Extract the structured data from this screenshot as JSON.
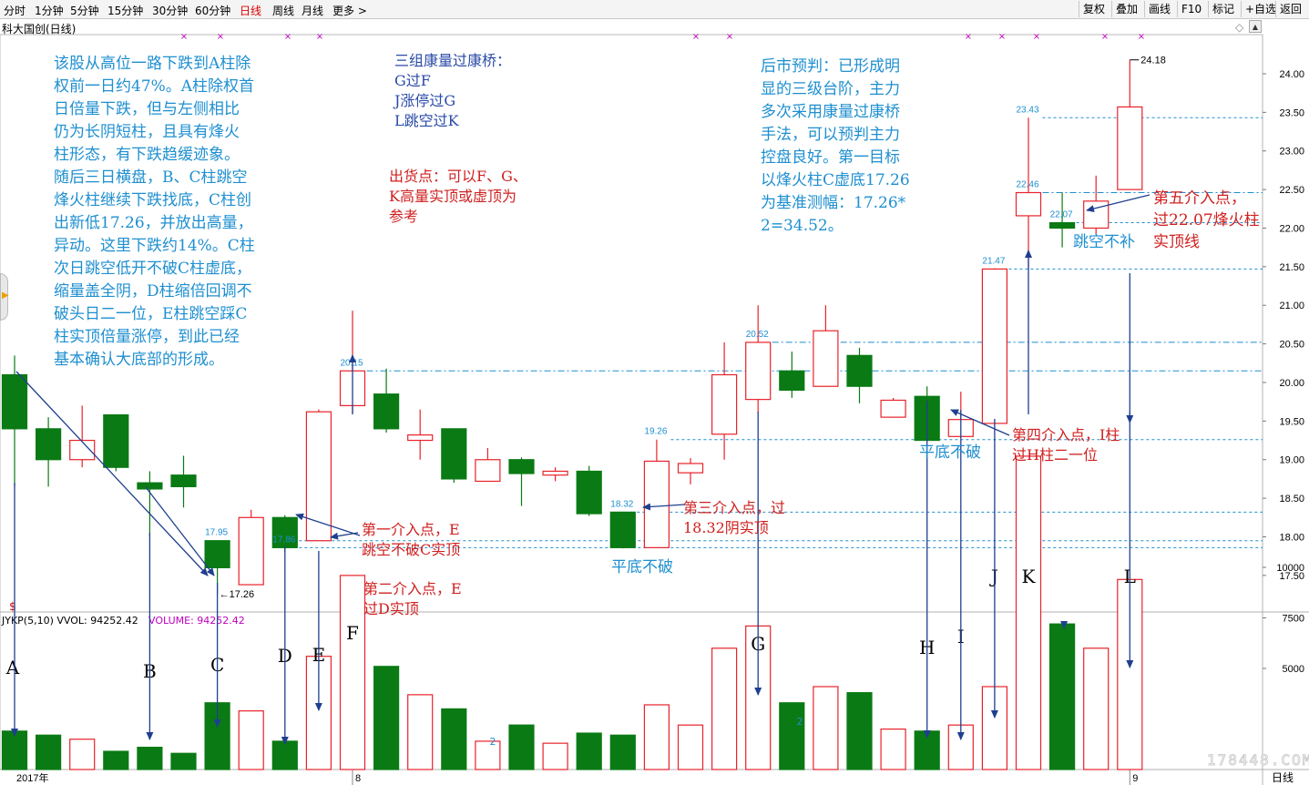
{
  "toolbar": {
    "periods": [
      "分时",
      "1分钟",
      "5分钟",
      "15分钟",
      "30分钟",
      "60分钟",
      "日线",
      "周线",
      "月线",
      "更多 >"
    ],
    "active": "日线",
    "right": [
      "复权",
      "叠加",
      "画线",
      "F10",
      "标记",
      "+自选",
      "返回"
    ]
  },
  "title": "科大国创(日线)",
  "vol_header": {
    "main": "JYKP(5,10)  VVOL: 94252.42",
    "extra": "VOLUME: 94252.42"
  },
  "chart_data": {
    "type": "candlestick",
    "title": "科大国创(日线)",
    "price_axis": {
      "ticks": [
        17.5,
        18.0,
        18.5,
        19.0,
        19.5,
        20.0,
        20.5,
        21.0,
        21.5,
        22.0,
        22.5,
        23.0,
        23.5,
        24.0
      ],
      "range": [
        17.05,
        24.46
      ]
    },
    "volume_axis": {
      "ticks": [
        5000,
        7500,
        10000
      ],
      "range": [
        0,
        17000
      ]
    },
    "x_labels": [
      {
        "text": "2017年",
        "index": 0
      },
      {
        "text": "8",
        "index": 10
      },
      {
        "text": "9",
        "index": 33
      }
    ],
    "bottom_right_label": "日线",
    "candles": [
      {
        "o": 20.1,
        "h": 20.35,
        "l": 18.65,
        "c": 19.4,
        "v": 1900
      },
      {
        "o": 19.4,
        "h": 19.55,
        "l": 18.65,
        "c": 19.0,
        "v": 1700
      },
      {
        "o": 19.0,
        "h": 19.7,
        "l": 18.9,
        "c": 19.25,
        "v": 1500
      },
      {
        "o": 19.58,
        "h": 19.58,
        "l": 18.85,
        "c": 18.9,
        "v": 900
      },
      {
        "o": 18.7,
        "h": 18.85,
        "l": 18.0,
        "c": 18.62,
        "v": 1100
      },
      {
        "o": 18.8,
        "h": 19.05,
        "l": 18.38,
        "c": 18.65,
        "v": 800
      },
      {
        "o": 17.95,
        "h": 17.95,
        "l": 17.26,
        "c": 17.6,
        "v": 3300
      },
      {
        "o": 17.38,
        "h": 18.35,
        "l": 17.38,
        "c": 18.25,
        "v": 2900
      },
      {
        "o": 18.25,
        "h": 18.28,
        "l": 17.8,
        "c": 17.86,
        "v": 1400
      },
      {
        "o": 17.95,
        "h": 19.65,
        "l": 17.95,
        "c": 19.62,
        "v": 5600
      },
      {
        "o": 19.7,
        "h": 20.93,
        "l": 19.6,
        "c": 20.15,
        "v": 9600
      },
      {
        "o": 19.85,
        "h": 20.18,
        "l": 19.35,
        "c": 19.4,
        "v": 5100
      },
      {
        "o": 19.25,
        "h": 19.65,
        "l": 19.0,
        "c": 19.32,
        "v": 3700
      },
      {
        "o": 19.4,
        "h": 19.4,
        "l": 18.7,
        "c": 18.75,
        "v": 3000
      },
      {
        "o": 18.72,
        "h": 19.15,
        "l": 18.72,
        "c": 19.0,
        "v": 1400
      },
      {
        "o": 19.0,
        "h": 19.03,
        "l": 18.4,
        "c": 18.82,
        "v": 2200
      },
      {
        "o": 18.8,
        "h": 18.9,
        "l": 18.72,
        "c": 18.85,
        "v": 1300
      },
      {
        "o": 18.85,
        "h": 18.92,
        "l": 18.27,
        "c": 18.3,
        "v": 1800
      },
      {
        "o": 18.32,
        "h": 18.32,
        "l": 17.85,
        "c": 17.86,
        "v": 1700
      },
      {
        "o": 17.86,
        "h": 19.26,
        "l": 17.86,
        "c": 18.98,
        "v": 3200
      },
      {
        "o": 18.83,
        "h": 19.02,
        "l": 18.68,
        "c": 18.95,
        "v": 2200
      },
      {
        "o": 19.33,
        "h": 20.52,
        "l": 19.0,
        "c": 20.1,
        "v": 6000
      },
      {
        "o": 19.78,
        "h": 21.0,
        "l": 19.6,
        "c": 20.52,
        "v": 7100
      },
      {
        "o": 20.15,
        "h": 20.4,
        "l": 19.8,
        "c": 19.9,
        "v": 3300
      },
      {
        "o": 19.95,
        "h": 21.0,
        "l": 19.95,
        "c": 20.67,
        "v": 4100
      },
      {
        "o": 20.35,
        "h": 20.45,
        "l": 19.73,
        "c": 19.95,
        "v": 3800
      },
      {
        "o": 19.55,
        "h": 19.8,
        "l": 19.55,
        "c": 19.77,
        "v": 2000
      },
      {
        "o": 19.82,
        "h": 19.95,
        "l": 19.25,
        "c": 19.25,
        "v": 1900
      },
      {
        "o": 19.3,
        "h": 19.88,
        "l": 19.3,
        "c": 19.52,
        "v": 2200
      },
      {
        "o": 19.47,
        "h": 21.48,
        "l": 19.47,
        "c": 21.47,
        "v": 4100
      },
      {
        "o": 22.16,
        "h": 23.43,
        "l": 21.47,
        "c": 22.46,
        "v": 15500
      },
      {
        "o": 22.07,
        "h": 22.46,
        "l": 21.75,
        "c": 22.0,
        "v": 7200
      },
      {
        "o": 22.0,
        "h": 22.68,
        "l": 21.92,
        "c": 22.35,
        "v": 6000
      },
      {
        "o": 22.5,
        "h": 24.18,
        "l": 22.5,
        "c": 23.57,
        "v": 9400
      }
    ],
    "price_labels": [
      {
        "text": "17.95",
        "i": 6,
        "p": 17.95,
        "pos": "above"
      },
      {
        "text": "←17.26",
        "i": 6,
        "p": 17.26,
        "pos": "right"
      },
      {
        "text": "17.86",
        "i": 8,
        "p": 17.86,
        "pos": "above"
      },
      {
        "text": "20.15",
        "i": 10,
        "p": 20.15,
        "pos": "above"
      },
      {
        "text": "18.32",
        "i": 18,
        "p": 18.32,
        "pos": "above"
      },
      {
        "text": "19.26",
        "i": 19,
        "p": 19.26,
        "pos": "above"
      },
      {
        "text": "20.52",
        "i": 22,
        "p": 20.52,
        "pos": "above"
      },
      {
        "text": "21.47",
        "i": 29,
        "p": 21.47,
        "pos": "above"
      },
      {
        "text": "22.46",
        "i": 30,
        "p": 22.46,
        "pos": "above"
      },
      {
        "text": "23.43",
        "i": 30,
        "p": 23.43,
        "pos": "above"
      },
      {
        "text": "22.07",
        "i": 31,
        "p": 22.07,
        "pos": "above"
      },
      {
        "text": "24.18",
        "i": 33,
        "p": 24.18,
        "pos": "right"
      }
    ],
    "reference_lines": [
      {
        "p": 17.86,
        "from": 8,
        "style": "dash"
      },
      {
        "p": 17.95,
        "from": 8,
        "style": "dash"
      },
      {
        "p": 18.32,
        "from": 18,
        "style": "dash"
      },
      {
        "p": 19.26,
        "from": 19,
        "style": "dash"
      },
      {
        "p": 20.15,
        "from": 10,
        "style": "dashdot"
      },
      {
        "p": 20.52,
        "from": 22,
        "style": "dashdot"
      },
      {
        "p": 21.47,
        "from": 29,
        "style": "dash"
      },
      {
        "p": 22.07,
        "from": 31,
        "style": "dash"
      },
      {
        "p": 22.46,
        "from": 30,
        "style": "dashdot"
      },
      {
        "p": 23.43,
        "from": 30,
        "style": "dash"
      }
    ],
    "top_markers": [
      "×",
      "×",
      "×",
      "×",
      "×",
      "×",
      "×",
      "×",
      "×",
      "×",
      "×"
    ],
    "vol_marker_text": "2",
    "dividend_marker": "$",
    "letters": [
      {
        "text": "A",
        "i": 0
      },
      {
        "text": "B",
        "i": 4
      },
      {
        "text": "C",
        "i": 6
      },
      {
        "text": "D",
        "i": 8
      },
      {
        "text": "E",
        "i": 9
      },
      {
        "text": "F",
        "i": 10
      },
      {
        "text": "G",
        "i": 22
      },
      {
        "text": "H",
        "i": 27
      },
      {
        "text": "I",
        "i": 28
      },
      {
        "text": "J",
        "i": 29
      },
      {
        "text": "K",
        "i": 30
      },
      {
        "text": "L",
        "i": 33
      }
    ]
  },
  "annotations": {
    "story": "该股从高位一路下跌到A柱除\n权前一日约47%。A柱除权首\n日倍量下跌，但与左侧相比\n仍为长阴短柱，且具有烽火\n柱形态，有下跌趋缓迹象。\n随后三日横盘，B、C柱跳空\n烽火柱继续下跌找底，C柱创\n出新低17.26，并放出高量，\n异动。这里下跌约14%。C柱\n次日跳空低开不破C柱虚底，\n缩量盖全阴，D柱缩倍回调不\n破头日二一位，E柱跳空踩C\n柱实顶倍量涨停，到此已经\n基本确认大底部的形成。",
    "bridges": "三组康量过康桥：\nG过F\nJ涨停过G\nL跳空过K",
    "sell": "出货点：可以F、G、\nK高量实顶或虚顶为\n参考",
    "forecast": "后市预判：已形成明\n显的三级台阶，主力\n多次采用康量过康桥\n手法，可以预判主力\n控盘良好。第一目标\n以烽火柱C虚底17.26\n为基准测幅：17.26*\n2=34.52。",
    "entry1": "第一介入点，E\n跳空不破C实顶",
    "entry2": "第二介入点，E\n过D实顶",
    "entry3": "第三介入点，过\n18.32阴实顶",
    "entry4": "第四介入点，I柱\n过H柱二一位",
    "entry5": "第五介入点，\n过22.07烽火柱\n实顶线",
    "flat1": "平底不破",
    "flat2": "平底不破",
    "gap": "跳空不补"
  },
  "watermark": "178448.COM"
}
